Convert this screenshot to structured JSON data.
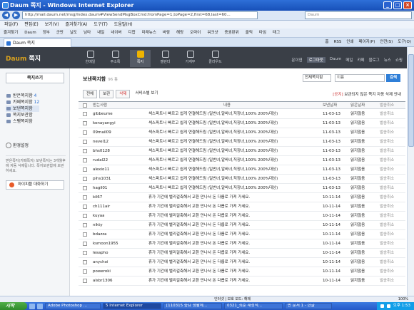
{
  "window": {
    "title": "Daum 쪽지 - Windows Internet Explorer"
  },
  "address": {
    "url": "http://mail.daum.net/msg/Index.daum#ViewSendMsgBoxCmd:fromPage=1,toPage=2,first=68,last=60...",
    "search_placeholder": "Daum"
  },
  "menu": [
    "파일(F)",
    "편집(E)",
    "보기(V)",
    "즐겨찾기(A)",
    "도구(T)",
    "도움말(H)"
  ],
  "favorites": [
    "즐겨찾기",
    "Daum",
    "정부",
    "군만",
    "날도",
    "남타",
    "내일",
    "네이버",
    "디합",
    "미래뉴스",
    "바람",
    "해랑",
    "오마이",
    "워크샷",
    "증권판위",
    "클릭",
    "타임",
    "태그"
  ],
  "tab": {
    "label": "Daum 쪽지"
  },
  "commands": [
    "홈",
    "RSS",
    "인쇄",
    "페이지(P)",
    "안전(S)",
    "도구(O)"
  ],
  "header": {
    "logo_main": "Daum",
    "logo_sub": "쪽지",
    "nav": [
      "한메일",
      "주소록",
      "쪽지",
      "캘린더",
      "가계부",
      "클라우드"
    ],
    "right_links": [
      "문이엽",
      "로그아웃",
      "Daum",
      "메일",
      "카페",
      "블로그",
      "뉴스",
      "쇼핑"
    ]
  },
  "sidebar": {
    "write_label": "쪽지쓰기",
    "folders": [
      {
        "label": "받은쪽지함",
        "count": "4"
      },
      {
        "label": "카페쪽지함",
        "count": "12"
      },
      {
        "label": "보낸쪽지함",
        "count": ""
      },
      {
        "label": "쪽지보관함",
        "count": ""
      },
      {
        "label": "스팸쪽지함",
        "count": ""
      }
    ],
    "setting_label": "환경설정",
    "notice": "받은쪽지(카페쪽지) 보낸쪽지는 3개월후에 자동 삭제됩니다. 쪽지보관함에 보관하세요.",
    "people_btn": "마이피플 대화하기"
  },
  "main": {
    "title": "보낸쪽지함",
    "count": "96 통",
    "search_select": "전체쪽지함",
    "search_input": "이름",
    "search_btn": "검색",
    "toolbar": [
      "전체",
      "보관",
      "삭제",
      "서비스별 보기"
    ],
    "notice_prefix": "[공지]",
    "notice_text": "보관되지 않은 쪽지 자동 삭제 안내",
    "columns": [
      "받는사람",
      "내용",
      "보낸날짜",
      "읽은날짜",
      "발송취소"
    ],
    "rows": [
      {
        "to": "gibbeume",
        "content": "섹스파트너 빠르고 쉽게 연결해드림 (일반녀,알바녀,직장녀,100% 200%대상)",
        "sent": "11-03-13",
        "read": "읽지않음",
        "cancel": "발송취소"
      },
      {
        "to": "konayangyi",
        "content": "섹스파트너 빠르고 쉽게 연결해드림 (일반녀,알바녀,직장녀,100% 200%대상)",
        "sent": "11-03-13",
        "read": "읽지않음",
        "cancel": "발송취소"
      },
      {
        "to": "09mail09",
        "content": "섹스파트너 빠르고 쉽게 연결해드림 (일반녀,알바녀,직장녀,100% 200%대상)",
        "sent": "11-03-13",
        "read": "읽지않음",
        "cancel": "발송취소"
      },
      {
        "to": "nevel12",
        "content": "섹스파트너 빠르고 쉽게 연결해드림 (일반녀,알바녀,직장녀,100% 200%대상)",
        "sent": "11-03-13",
        "read": "읽지않음",
        "cancel": "발송취소"
      },
      {
        "to": "bhs0128",
        "content": "섹스파트너 빠르고 쉽게 연결해드림 (일반녀,알바녀,직장녀,100% 200%대상)",
        "sent": "11-03-13",
        "read": "읽지않음",
        "cancel": "발송취소"
      },
      {
        "to": "rudal22",
        "content": "섹스파트너 빠르고 쉽게 연결해드림 (일반녀,알바녀,직장녀,100% 200%대상)",
        "sent": "11-03-13",
        "read": "읽지않음",
        "cancel": "발송취소"
      },
      {
        "to": "alexio11",
        "content": "섹스파트너 빠르고 쉽게 연결해드림 (일반녀,알바녀,직장녀,100% 200%대상)",
        "sent": "11-03-13",
        "read": "읽지않음",
        "cancel": "발송취소"
      },
      {
        "to": "pihs1031",
        "content": "섹스파트너 빠르고 쉽게 연결해드림 (일반녀,알바녀,직장녀,100% 200%대상)",
        "sent": "11-03-13",
        "read": "읽지않음",
        "cancel": "발송취소"
      },
      {
        "to": "hagil01",
        "content": "섹스파트너 빠르고 쉽게 연결해드림 (일반녀,알바녀,직장녀,100% 200%대상)",
        "sent": "11-03-13",
        "read": "읽지않음",
        "cancel": "발송취소"
      },
      {
        "to": "kil67",
        "content": "휴가 기간에 밸리걸축해서 교환 만나서 돈 다릅로 가져 가세요.",
        "sent": "10-11-14",
        "read": "읽지않음",
        "cancel": "발송취소"
      },
      {
        "to": "ch111air",
        "content": "휴가 기간에 밸리걸축해서 교환 만나서 돈 다릅로 가져 가세요.",
        "sent": "10-11-14",
        "read": "읽지않음",
        "cancel": "발송취소"
      },
      {
        "to": "kuyaa",
        "content": "휴가 기간에 밸리걸축해서 교환 만나서 돈 다릅로 가져 가세요.",
        "sent": "10-11-14",
        "read": "읽지않음",
        "cancel": "발송취소"
      },
      {
        "to": "nikty",
        "content": "휴가 기간에 밸리걸축해서 교환 만나서 돈 다릅로 가져 가세요.",
        "sent": "10-11-14",
        "read": "읽지않음",
        "cancel": "발송취소"
      },
      {
        "to": "bdazza",
        "content": "휴가 기간에 밸리걸축해서 교환 만나서 돈 다릅로 가져 가세요.",
        "sent": "10-11-14",
        "read": "읽지않음",
        "cancel": "발송취소"
      },
      {
        "to": "ksmoon1955",
        "content": "휴가 기간에 밸리걸축해서 교환 만나서 돈 다릅로 가져 가세요.",
        "sent": "10-11-14",
        "read": "읽지않음",
        "cancel": "발송취소"
      },
      {
        "to": "lesapho",
        "content": "휴가 기간에 밸리걸축해서 교환 만나서 돈 다릅로 가져 가세요.",
        "sent": "10-11-14",
        "read": "읽지않음",
        "cancel": "발송취소"
      },
      {
        "to": "anychoi",
        "content": "휴가 기간에 밸리걸축해서 교환 만나서 돈 다릅로 가져 가세요.",
        "sent": "10-11-14",
        "read": "읽지않음",
        "cancel": "발송취소"
      },
      {
        "to": "poweroki",
        "content": "휴가 기간에 밸리걸축해서 교환 만나서 돈 다릅로 가져 가세요.",
        "sent": "10-11-14",
        "read": "읽지않음",
        "cancel": "발송취소"
      },
      {
        "to": "alsbr1306",
        "content": "휴가 기간에 밸리걸축해서 교환 만나서 돈 다릅로 가져 가세요.",
        "sent": "10-11-14",
        "read": "읽지않음",
        "cancel": "발송취소"
      }
    ]
  },
  "statusbar": {
    "text": "인터넷 | 보호 모드: 해제",
    "zoom": "100%"
  },
  "taskbar": {
    "start": "시작",
    "items": [
      "Adobe Photoshop ...",
      "5 Internet Explorer",
      "[110315 중요 생활체...",
      "0321_최순 재정적...",
      "반 문서 1 - 한글"
    ],
    "clock": "오후 1:53"
  },
  "colors": {
    "accent": "#2f7fd8",
    "header_bg": "#3a3f47",
    "active_nav": "#f0b400"
  }
}
